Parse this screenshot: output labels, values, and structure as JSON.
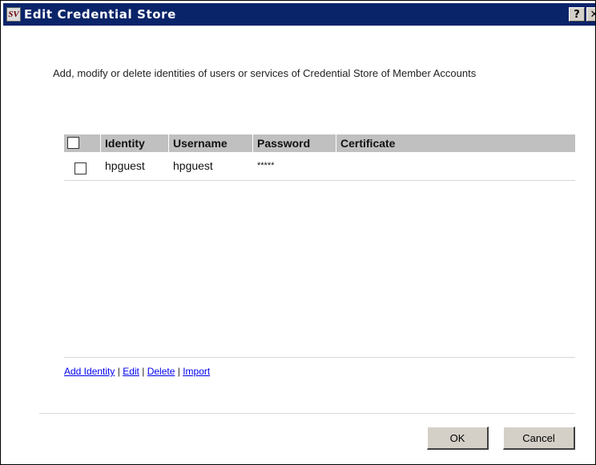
{
  "window": {
    "title": "Edit Credential Store",
    "app_icon_text": "SV",
    "help_label": "?",
    "close_label": "✕"
  },
  "description": "Add, modify or delete identities of users or services of Credential Store of Member Accounts",
  "grid": {
    "columns": [
      "Identity",
      "Username",
      "Password",
      "Certificate"
    ],
    "rows": [
      {
        "checked": false,
        "identity": "hpguest",
        "username": "hpguest",
        "password": "*****",
        "certificate": ""
      }
    ]
  },
  "links": {
    "add_identity": "Add Identity",
    "edit": "Edit",
    "delete": "Delete",
    "import": "Import",
    "separator": "|"
  },
  "buttons": {
    "ok": "OK",
    "cancel": "Cancel"
  },
  "colors": {
    "titlebar": "#0a246a",
    "header_bg": "#c0c0c0",
    "link": "#0000ee"
  }
}
